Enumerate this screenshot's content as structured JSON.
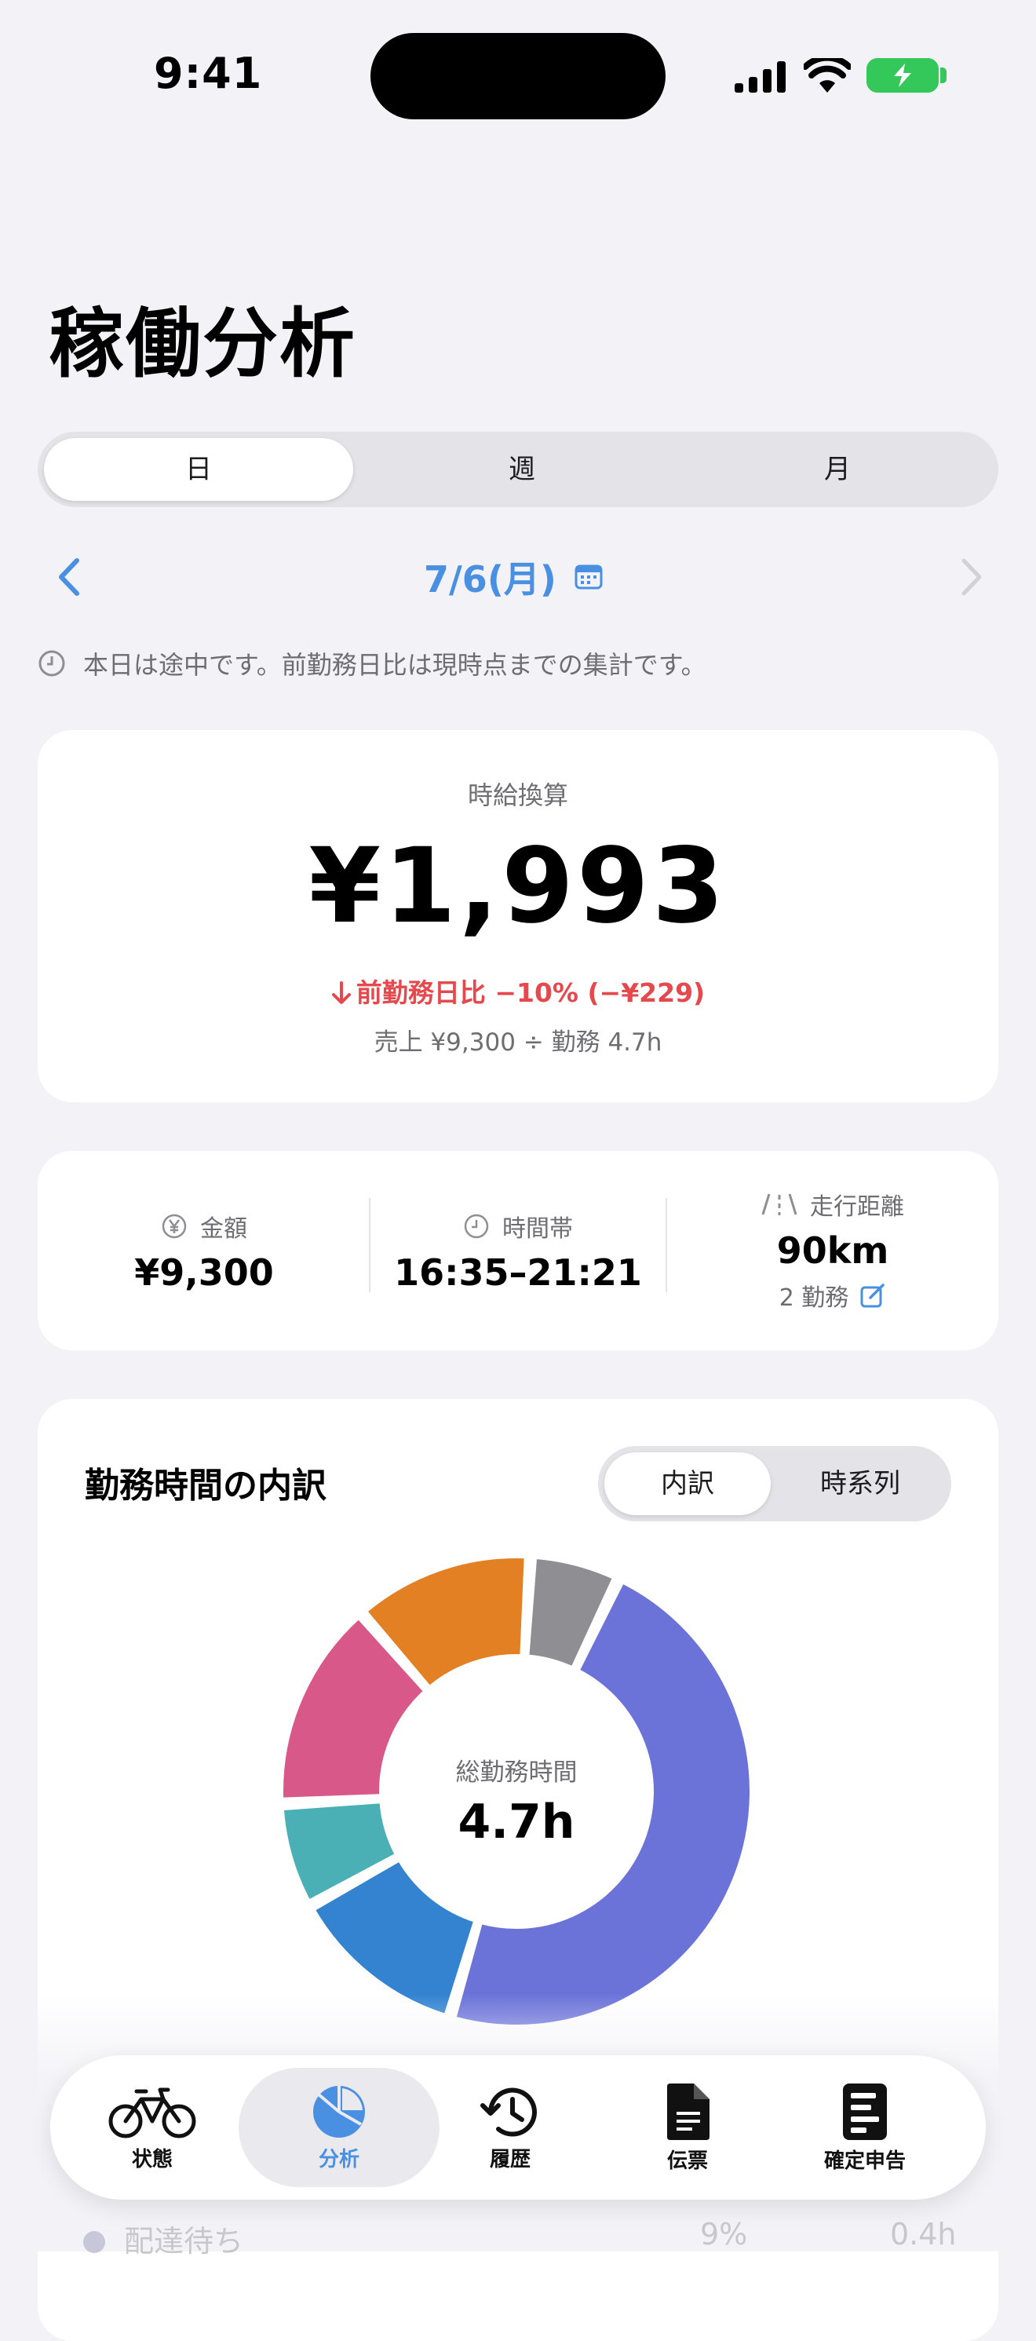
{
  "status_bar": {
    "time": "9:41"
  },
  "header": {
    "title": "稼働分析"
  },
  "period_tabs": [
    {
      "label": "日",
      "active": true
    },
    {
      "label": "週",
      "active": false
    },
    {
      "label": "月",
      "active": false
    }
  ],
  "date_nav": {
    "date": "7/6(月)"
  },
  "notice": "本日は途中です。前勤務日比は現時点までの集計です。",
  "hourly_card": {
    "label": "時給換算",
    "value": "¥1,993",
    "change": "前勤務日比 −10% (−¥229)",
    "formula": "売上 ¥9,300 ÷ 勤務 4.7h"
  },
  "stats": {
    "amount": {
      "label": "金額",
      "value": "¥9,300"
    },
    "time_range": {
      "label": "時間帯",
      "value": "16:35–21:21"
    },
    "distance": {
      "label": "走行距離",
      "value": "90km",
      "sub": "2 勤務"
    }
  },
  "breakdown": {
    "title": "勤務時間の内訳",
    "toggle": [
      {
        "label": "内訳",
        "active": true
      },
      {
        "label": "時系列",
        "active": false
      }
    ],
    "center_label": "総勤務時間",
    "center_value": "4.7h",
    "hidden_rows": [
      {
        "label": "配達待ち",
        "percent": "9%",
        "hours": "0.4h"
      }
    ]
  },
  "chart_data": {
    "type": "pie",
    "center_label": "総勤務時間",
    "center_value": "4.7h",
    "slices": [
      {
        "value": 6,
        "color": "#8e8e93"
      },
      {
        "value": 46,
        "color": "#6b73d9"
      },
      {
        "value": 12,
        "color": "#3383d1"
      },
      {
        "value": 7,
        "color": "#4bb0b5"
      },
      {
        "value": 14,
        "color": "#d9588a"
      },
      {
        "value": 12,
        "color": "#e38024"
      }
    ]
  },
  "tabbar": [
    {
      "label": "状態",
      "icon": "bicycle-icon",
      "active": false
    },
    {
      "label": "分析",
      "icon": "pie-chart-icon",
      "active": true
    },
    {
      "label": "履歴",
      "icon": "history-icon",
      "active": false
    },
    {
      "label": "伝票",
      "icon": "document-icon",
      "active": false
    },
    {
      "label": "確定申告",
      "icon": "tax-return-icon",
      "active": false
    }
  ],
  "colors": {
    "accent": "#4a90e2",
    "negative": "#e5484d"
  }
}
